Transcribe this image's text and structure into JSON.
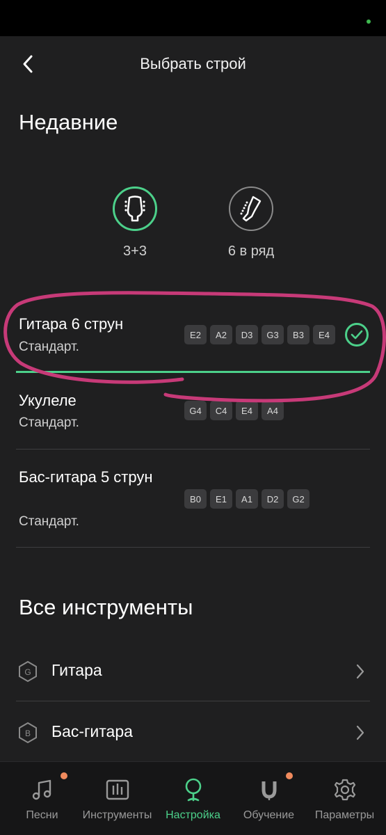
{
  "header": {
    "title": "Выбрать строй"
  },
  "recent": {
    "title": "Недавние",
    "icons": [
      {
        "label": "3+3"
      },
      {
        "label": "6 в ряд"
      }
    ],
    "tunings": [
      {
        "name": "Гитара 6 струн",
        "style": "Стандарт.",
        "notes": [
          "E2",
          "A2",
          "D3",
          "G3",
          "B3",
          "E4"
        ],
        "selected": true
      },
      {
        "name": "Укулеле",
        "style": "Стандарт.",
        "notes": [
          "G4",
          "C4",
          "E4",
          "A4"
        ],
        "selected": false
      },
      {
        "name": "Бас-гитара 5 струн",
        "style": "Стандарт.",
        "notes": [
          "B0",
          "E1",
          "A1",
          "D2",
          "G2"
        ],
        "selected": false
      }
    ]
  },
  "all_instruments": {
    "title": "Все инструменты",
    "items": [
      {
        "name": "Гитара",
        "letter": "G"
      },
      {
        "name": "Бас-гитара",
        "letter": "B"
      }
    ]
  },
  "tabbar": {
    "tabs": [
      {
        "label": "Песни",
        "badge": true
      },
      {
        "label": "Инструменты",
        "badge": false
      },
      {
        "label": "Настройка",
        "badge": false,
        "active": true
      },
      {
        "label": "Обучение",
        "badge": true
      },
      {
        "label": "Параметры",
        "badge": false
      }
    ]
  },
  "colors": {
    "accent": "#4cd08a",
    "highlight": "#c73a78",
    "badge": "#f08a5d",
    "background": "#1f1f20"
  }
}
